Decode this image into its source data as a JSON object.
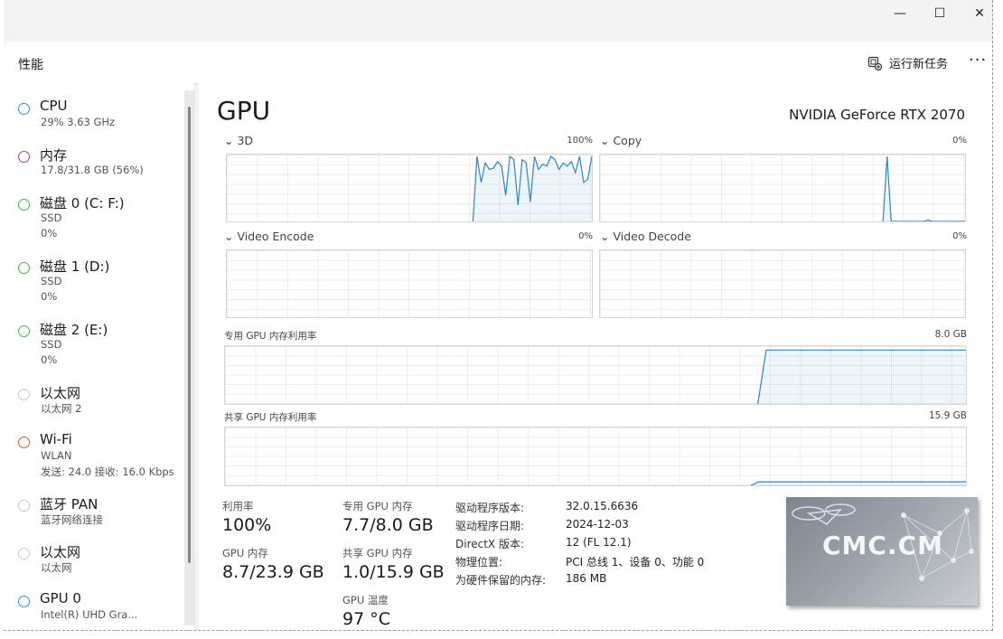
{
  "window": {
    "minimize_glyph": "—",
    "maximize_glyph": "☐",
    "close_glyph": "✕"
  },
  "header": {
    "title": "性能",
    "run_task_label": "运行新任务",
    "more_glyph": "···"
  },
  "sidebar": {
    "items": [
      {
        "name": "CPU",
        "sub1": "29%  3.63 GHz",
        "sub2": "",
        "color": "#3b8ed0"
      },
      {
        "name": "内存",
        "sub1": "17.8/31.8 GB (56%)",
        "sub2": "",
        "color": "#9b3fb0"
      },
      {
        "name": "磁盘 0 (C: F:)",
        "sub1": "SSD",
        "sub2": "0%",
        "color": "#4caf50"
      },
      {
        "name": "磁盘 1 (D:)",
        "sub1": "SSD",
        "sub2": "0%",
        "color": "#4caf50"
      },
      {
        "name": "磁盘 2 (E:)",
        "sub1": "SSD",
        "sub2": "0%",
        "color": "#4caf50"
      },
      {
        "name": "以太网",
        "sub1": "以太网 2",
        "sub2": "",
        "color": "#bdbdbd"
      },
      {
        "name": "Wi-Fi",
        "sub1": "WLAN",
        "sub2": "发送: 24.0  接收: 16.0 Kbps",
        "color": "#c0642a"
      },
      {
        "name": "蓝牙 PAN",
        "sub1": "蓝牙网络连接",
        "sub2": "",
        "color": "#bdbdbd"
      },
      {
        "name": "以太网",
        "sub1": "以太网",
        "sub2": "",
        "color": "#bdbdbd"
      },
      {
        "name": "GPU 0",
        "sub1": "Intel(R) UHD Gra...",
        "sub2": "",
        "color": "#3b8ed0"
      }
    ]
  },
  "gpu": {
    "title": "GPU",
    "model": "NVIDIA GeForce RTX 2070",
    "engines": [
      {
        "label": "3D",
        "pct": "100%"
      },
      {
        "label": "Copy",
        "pct": "0%"
      },
      {
        "label": "Video Encode",
        "pct": "0%"
      },
      {
        "label": "Video Decode",
        "pct": "0%"
      }
    ],
    "dedicated_label": "专用 GPU 内存利用率",
    "dedicated_max": "8.0 GB",
    "shared_label": "共享 GPU 内存利用率",
    "shared_max": "15.9 GB",
    "chart_data": [
      {
        "type": "line",
        "name": "3D",
        "ylim": [
          0,
          100
        ],
        "values": [
          0,
          0,
          0,
          0,
          0,
          0,
          0,
          0,
          0,
          0,
          0,
          0,
          0,
          0,
          0,
          0,
          0,
          0,
          0,
          0,
          0,
          0,
          0,
          0,
          0,
          0,
          0,
          0,
          0,
          0,
          0,
          0,
          0,
          0,
          0,
          0,
          0,
          0,
          0,
          0,
          0,
          0,
          0,
          0,
          0,
          0,
          0,
          0,
          0,
          0,
          0,
          0,
          0,
          0,
          0,
          0,
          0,
          0,
          0,
          0,
          0,
          100,
          60,
          90,
          80,
          82,
          92,
          85,
          40,
          100,
          95,
          25,
          95,
          90,
          30,
          100,
          80,
          88,
          85,
          100,
          95,
          80,
          90,
          85,
          92,
          75,
          100,
          60,
          65,
          100
        ]
      },
      {
        "type": "line",
        "name": "Copy",
        "ylim": [
          0,
          100
        ],
        "values": [
          0,
          0,
          0,
          0,
          0,
          0,
          0,
          0,
          0,
          0,
          0,
          0,
          0,
          0,
          0,
          0,
          0,
          0,
          0,
          0,
          0,
          0,
          0,
          0,
          0,
          0,
          0,
          0,
          0,
          0,
          0,
          0,
          0,
          0,
          0,
          0,
          0,
          0,
          0,
          0,
          0,
          0,
          0,
          0,
          0,
          0,
          0,
          0,
          0,
          0,
          0,
          0,
          0,
          0,
          0,
          0,
          0,
          0,
          0,
          0,
          0,
          0,
          0,
          0,
          0,
          0,
          0,
          0,
          0,
          0,
          100,
          0,
          0,
          0,
          0,
          0,
          0,
          0,
          0,
          0,
          2,
          0,
          0,
          0,
          0,
          0,
          0,
          0,
          0,
          0
        ]
      },
      {
        "type": "area",
        "name": "专用 GPU 内存利用率",
        "ylim": [
          0,
          8.0
        ],
        "values": [
          0,
          0,
          0,
          0,
          0,
          0,
          0,
          0,
          0,
          0,
          0,
          0,
          0,
          0,
          0,
          0,
          0,
          0,
          0,
          0,
          0,
          0,
          0,
          0,
          0,
          0,
          0,
          0,
          0,
          0,
          0,
          0,
          0,
          0,
          0,
          0,
          0,
          0,
          0,
          0,
          0,
          0,
          0,
          0,
          0,
          0,
          0,
          0,
          0,
          0,
          0,
          0,
          0,
          0,
          0,
          0,
          0,
          0,
          0,
          0,
          0,
          0,
          0,
          0,
          0,
          7.7,
          7.7,
          7.7,
          7.7,
          7.7,
          7.7,
          7.7,
          7.7,
          7.7,
          7.7,
          7.7,
          7.7,
          7.7,
          7.7,
          7.7,
          7.7,
          7.7,
          7.7,
          7.7,
          7.7,
          7.7,
          7.7,
          7.7,
          7.7,
          7.7
        ]
      },
      {
        "type": "area",
        "name": "共享 GPU 内存利用率",
        "ylim": [
          0,
          15.9
        ],
        "values": [
          0,
          0,
          0,
          0,
          0,
          0,
          0,
          0,
          0,
          0,
          0,
          0,
          0,
          0,
          0,
          0,
          0,
          0,
          0,
          0,
          0,
          0,
          0,
          0,
          0,
          0,
          0,
          0,
          0,
          0,
          0,
          0,
          0,
          0,
          0,
          0,
          0,
          0,
          0,
          0,
          0,
          0,
          0,
          0,
          0,
          0,
          0,
          0,
          0,
          0,
          0,
          0,
          0,
          0,
          0,
          0,
          0,
          0,
          0,
          0,
          0,
          0,
          0,
          0,
          0,
          0,
          0,
          1.0,
          1.0,
          1.0,
          1.0,
          1.0,
          1.0,
          1.0,
          1.0,
          1.0,
          1.0,
          1.0,
          1.0,
          1.0,
          1.0,
          1.0,
          1.0,
          1.0,
          1.0,
          1.0,
          1.0,
          1.0,
          1.0,
          1.0,
          1.0,
          1.0,
          1.0,
          1.0
        ]
      }
    ],
    "line_color": "#2a86c8",
    "stats": {
      "util_label": "利用率",
      "util_value": "100%",
      "mem_label": "GPU 内存",
      "mem_value": "8.7/23.9 GB",
      "ded_label": "专用 GPU 内存",
      "ded_value": "7.7/8.0 GB",
      "shr_label": "共享 GPU 内存",
      "shr_value": "1.0/15.9 GB",
      "temp_label": "GPU 温度",
      "temp_value": "97 °C"
    },
    "info": [
      {
        "key": "驱动程序版本:",
        "value": "32.0.15.6636"
      },
      {
        "key": "驱动程序日期:",
        "value": "2024-12-03"
      },
      {
        "key": "DirectX 版本:",
        "value": "12 (FL 12.1)"
      },
      {
        "key": "物理位置:",
        "value": "PCI 总线 1、设备 0、功能 0"
      },
      {
        "key": "为硬件保留的内存:",
        "value": "186 MB"
      }
    ]
  },
  "watermark": {
    "text": "CMC.CM"
  }
}
